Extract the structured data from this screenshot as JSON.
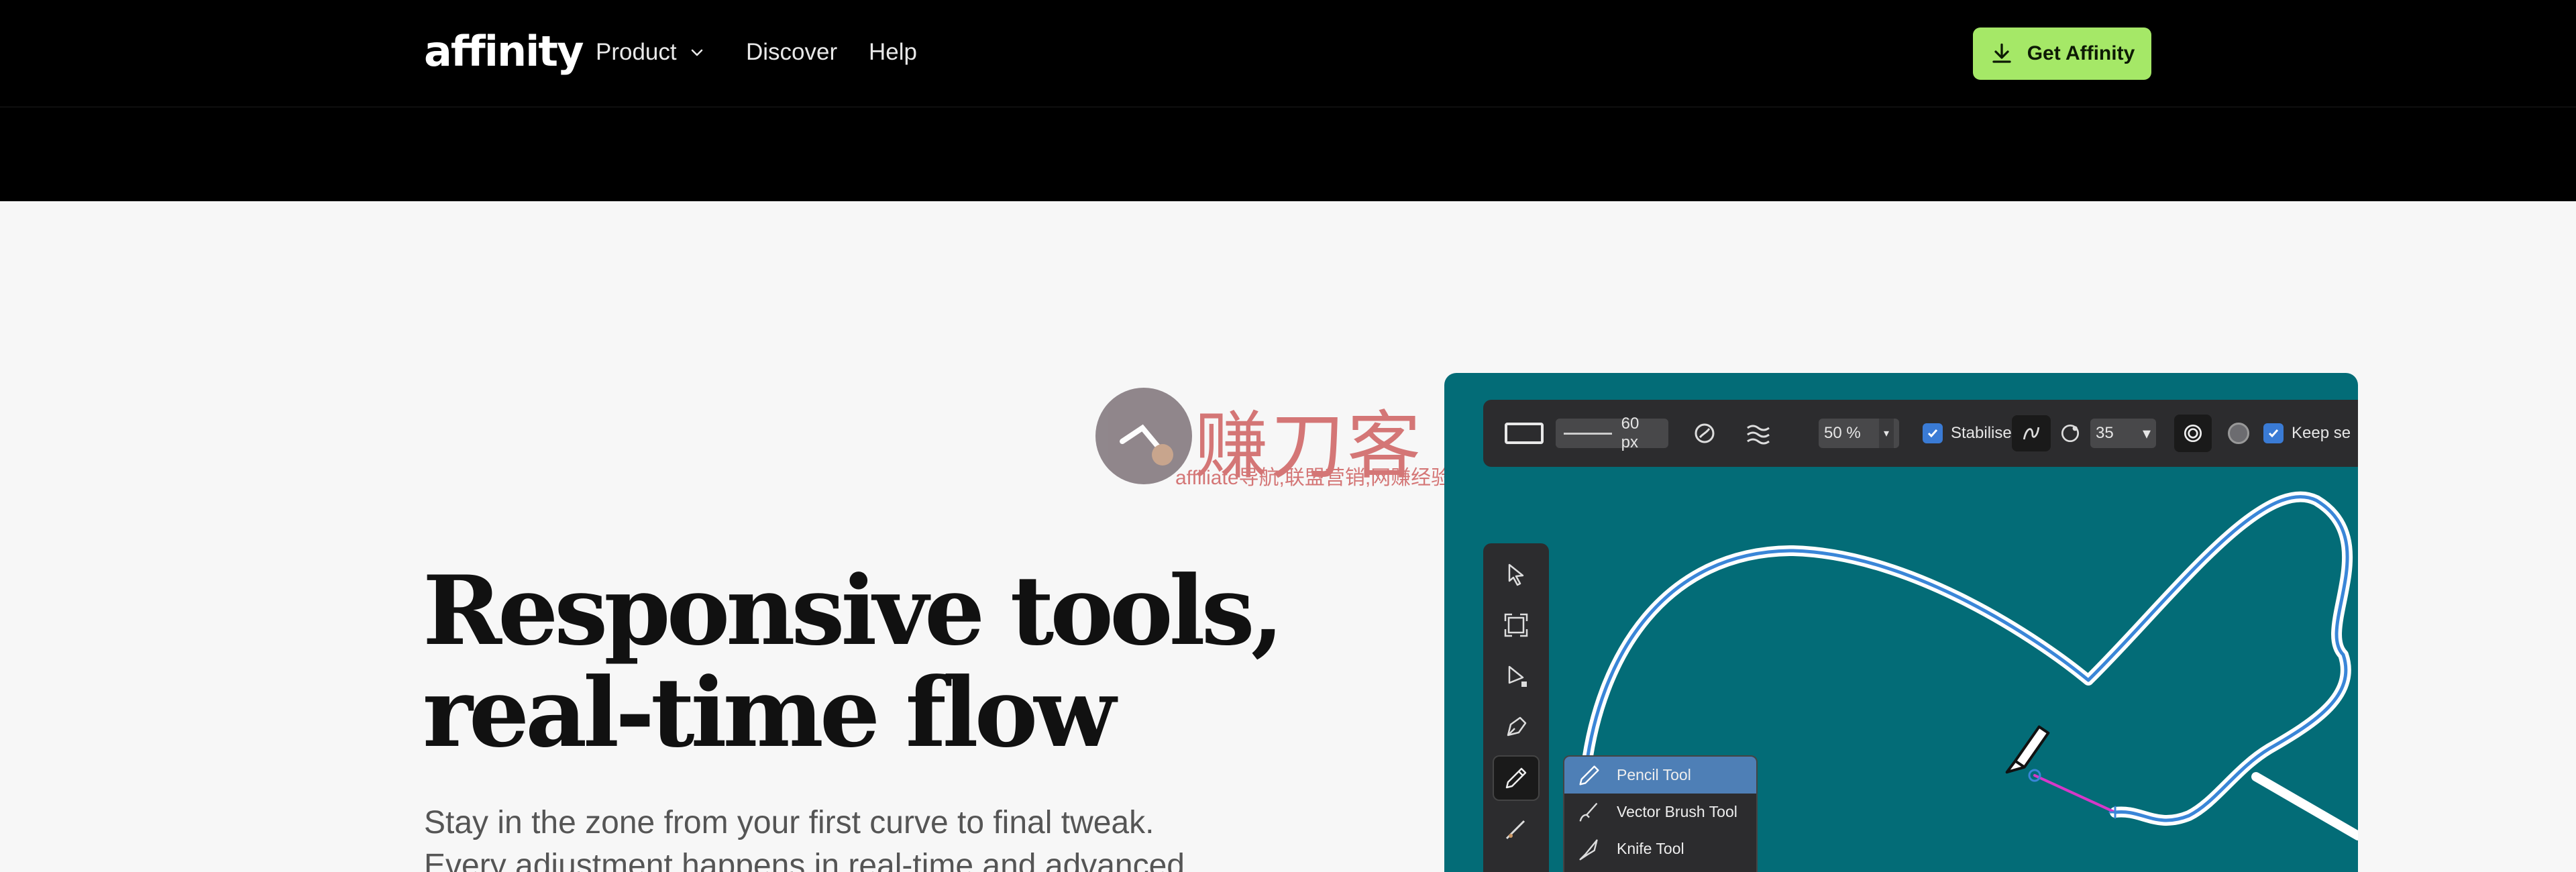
{
  "header": {
    "logo": "affinity",
    "nav": [
      {
        "label": "Product",
        "has_dropdown": true
      },
      {
        "label": "Discover"
      },
      {
        "label": "Help"
      }
    ],
    "cta_label": "Get Affinity",
    "cta_color": "#a5e867"
  },
  "hero": {
    "headline_lines": [
      "Responsive tools,",
      "real-time flow"
    ],
    "body_lines": [
      "Stay in the zone from your first curve to final tweak.",
      "Every adjustment happens in real-time and advanced"
    ]
  },
  "watermark": {
    "chars": "赚刀客",
    "subtitle": "affiliate导航,联盟营销,网赚经验"
  },
  "app": {
    "canvas_color": "#036c77",
    "context_toolbar": {
      "brush_width": "60 px",
      "opacity": "50 %",
      "stabiliser_label": "Stabiliser",
      "stabiliser_checked": true,
      "stabiliser_value": "35",
      "keep_label": "Keep se",
      "keep_checked": true
    },
    "tools": [
      {
        "name": "move-tool-icon"
      },
      {
        "name": "artboard-tool-icon"
      },
      {
        "name": "node-tool-icon"
      },
      {
        "name": "pen-tool-icon"
      },
      {
        "name": "pencil-tool-icon",
        "active": true
      },
      {
        "name": "vector-brush-tool-icon"
      }
    ],
    "flyout": [
      {
        "label": "Pencil Tool",
        "selected": true
      },
      {
        "label": "Vector Brush Tool"
      },
      {
        "label": "Knife Tool"
      }
    ]
  }
}
